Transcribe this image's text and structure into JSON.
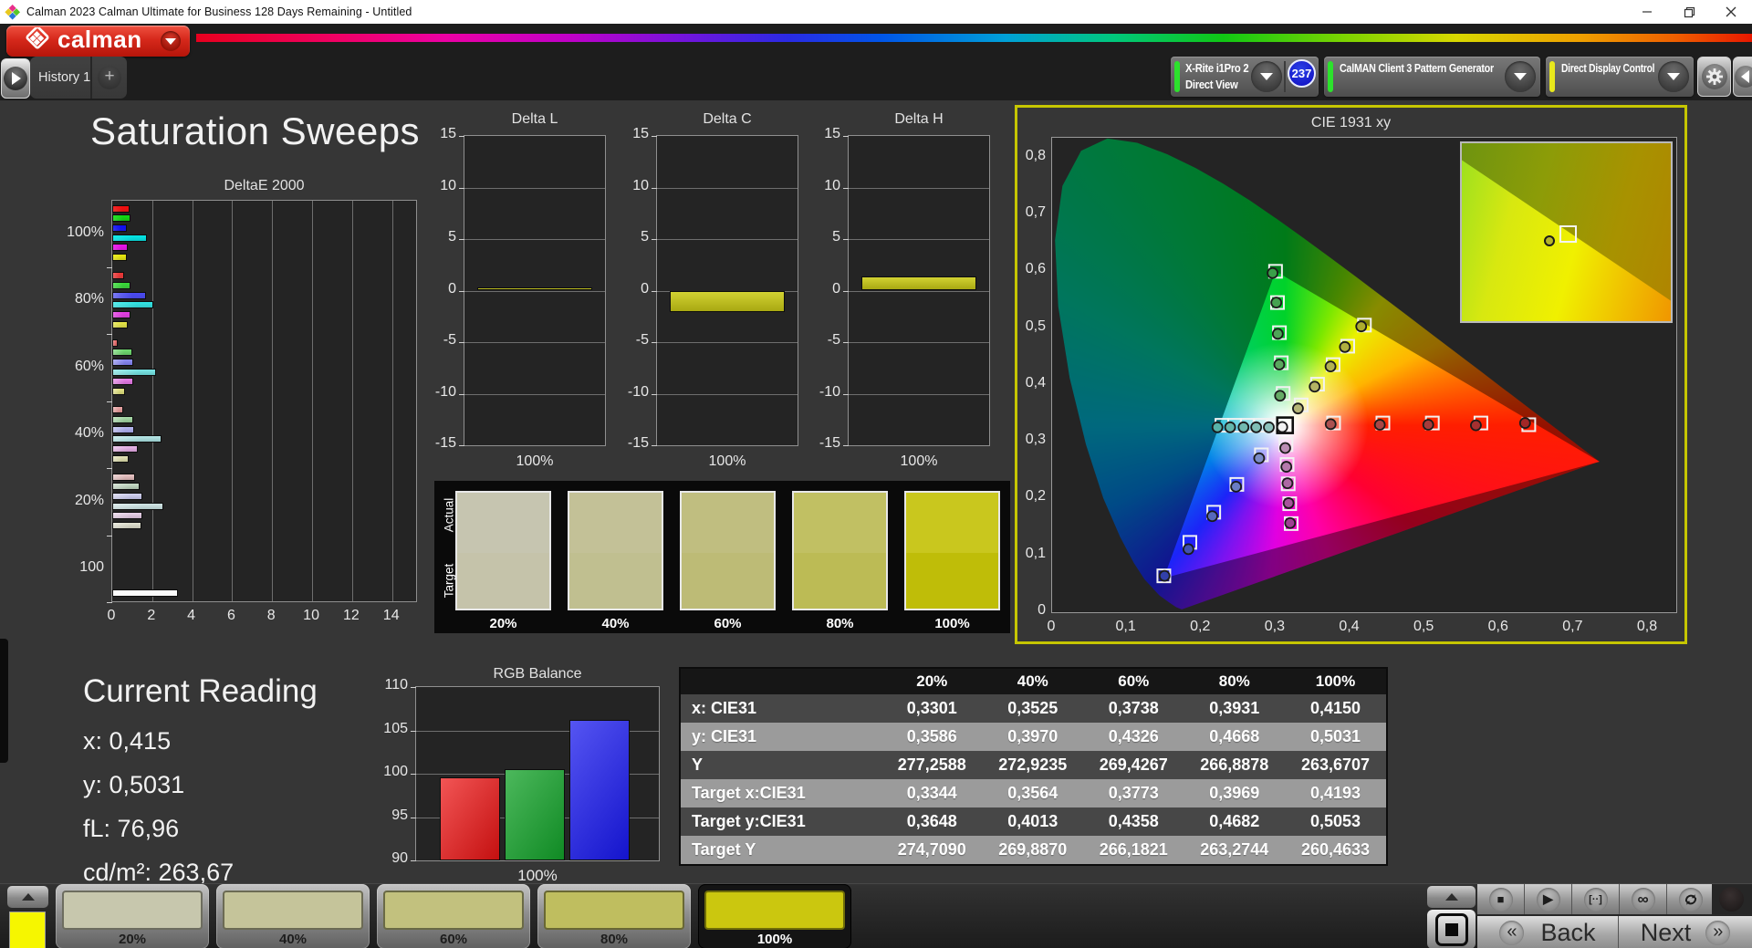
{
  "window": {
    "title": "Calman 2023 Calman Ultimate for Business 128 Days Remaining  - Untitled"
  },
  "brand": {
    "logo_text": "calman"
  },
  "tabs": {
    "items": [
      {
        "label": "History 1",
        "active": true
      }
    ],
    "add_label": "+"
  },
  "toolbar": {
    "meter": {
      "line1": "X-Rite i1Pro 2",
      "line2": "Direct View",
      "accent": "#2ce22c"
    },
    "badge": "237",
    "pattern_generator": {
      "label": "CalMAN Client 3 Pattern Generator",
      "accent": "#2ce22c"
    },
    "display_control": {
      "label": "Direct Display Control",
      "accent": "#e8e81c"
    }
  },
  "page": {
    "title": "Saturation Sweeps"
  },
  "current_reading": {
    "title": "Current Reading",
    "lines": [
      {
        "label": "x",
        "value": "0,415"
      },
      {
        "label": "y",
        "value": "0,5031"
      },
      {
        "label": "fL",
        "value": "76,96"
      },
      {
        "label": "cd/m²",
        "value": "263,67"
      }
    ]
  },
  "swatch_comparison": {
    "row_labels": [
      "Actual",
      "Target"
    ],
    "columns": [
      {
        "label": "20%",
        "actual": "#c6c5b0",
        "target": "#c5c3aa"
      },
      {
        "label": "40%",
        "actual": "#c3c197",
        "target": "#c0bf90"
      },
      {
        "label": "60%",
        "actual": "#c0be80",
        "target": "#bdbb76"
      },
      {
        "label": "80%",
        "actual": "#c1c063",
        "target": "#bcbb55"
      },
      {
        "label": "100%",
        "actual": "#c9c71e",
        "target": "#bfbd08"
      }
    ]
  },
  "table": {
    "headers": [
      "",
      "20%",
      "40%",
      "60%",
      "80%",
      "100%"
    ],
    "rows": [
      {
        "label": "x: CIE31",
        "shade": "dark",
        "values": [
          "0,3301",
          "0,3525",
          "0,3738",
          "0,3931",
          "0,4150"
        ]
      },
      {
        "label": "y: CIE31",
        "shade": "light",
        "values": [
          "0,3586",
          "0,3970",
          "0,4326",
          "0,4668",
          "0,5031"
        ]
      },
      {
        "label": "Y",
        "shade": "dark",
        "values": [
          "277,2588",
          "272,9235",
          "269,4267",
          "266,8878",
          "263,6707"
        ]
      },
      {
        "label": "Target x:CIE31",
        "shade": "light",
        "values": [
          "0,3344",
          "0,3564",
          "0,3773",
          "0,3969",
          "0,4193"
        ]
      },
      {
        "label": "Target y:CIE31",
        "shade": "dark",
        "values": [
          "0,3648",
          "0,4013",
          "0,4358",
          "0,4682",
          "0,5053"
        ]
      },
      {
        "label": "Target Y",
        "shade": "light",
        "values": [
          "274,7090",
          "269,8870",
          "266,1821",
          "263,2744",
          "260,4633"
        ]
      }
    ]
  },
  "bottom_bar": {
    "current_color": "#f6f600",
    "swatches": [
      {
        "label": "20%",
        "color": "#c7c7ad",
        "selected": false
      },
      {
        "label": "40%",
        "color": "#c5c49a",
        "selected": false
      },
      {
        "label": "60%",
        "color": "#c2c17e",
        "selected": false
      },
      {
        "label": "80%",
        "color": "#bfbe5f",
        "selected": false
      },
      {
        "label": "100%",
        "color": "#cbc70f",
        "selected": true
      }
    ],
    "transport": [
      {
        "name": "stop",
        "glyph": "■"
      },
      {
        "name": "play",
        "glyph": "▶"
      },
      {
        "name": "range",
        "glyph": "[··]"
      },
      {
        "name": "loop-infinite",
        "glyph": "∞"
      },
      {
        "name": "repeat",
        "glyph": "svg"
      }
    ],
    "back_label": "Back",
    "next_label": "Next"
  },
  "chart_data": [
    {
      "id": "deltae2000",
      "type": "bar",
      "orientation": "horizontal",
      "title": "DeltaE 2000",
      "xlim": [
        0,
        15.2
      ],
      "xticks": [
        0,
        2,
        4,
        6,
        8,
        10,
        12,
        14
      ],
      "grid": true,
      "categories": [
        "100%",
        "80%",
        "60%",
        "40%",
        "20%",
        "100"
      ],
      "groups": [
        {
          "label": "100%",
          "values": [
            0.85,
            0.92,
            0.75,
            1.75,
            0.78,
            0.75
          ],
          "colors": [
            "#d42a2a",
            "#2cb82c",
            "#2d2dd8",
            "#17c3c3",
            "#c92cc9",
            "#c6c62a"
          ]
        },
        {
          "label": "80%",
          "values": [
            0.6,
            0.92,
            1.7,
            2.05,
            0.92,
            0.78
          ],
          "colors": [
            "#cd5454",
            "#54b854",
            "#6161d4",
            "#4fc3c3",
            "#c358c3",
            "#c3c35e"
          ]
        },
        {
          "label": "60%",
          "values": [
            0.28,
            1.0,
            1.05,
            2.2,
            1.03,
            0.62
          ],
          "colors": [
            "#c97777",
            "#77b877",
            "#8585d2",
            "#7cc3c3",
            "#c47fc4",
            "#c0c081"
          ]
        },
        {
          "label": "40%",
          "values": [
            0.55,
            1.05,
            1.08,
            2.45,
            1.3,
            0.8
          ],
          "colors": [
            "#c79292",
            "#95b895",
            "#9e9ed0",
            "#9cc3c3",
            "#c59cc5",
            "#bfbf9c"
          ]
        },
        {
          "label": "20%",
          "values": [
            1.13,
            1.35,
            1.5,
            2.55,
            1.5,
            1.48
          ],
          "colors": [
            "#c4a6a6",
            "#a8b8a8",
            "#b1b1cf",
            "#b0c3c3",
            "#c4b0c4",
            "#bebeb0"
          ]
        },
        {
          "label": "100",
          "values": [
            3.3
          ],
          "colors": [
            "#f4f4f4"
          ]
        }
      ]
    },
    {
      "id": "delta_l",
      "type": "bar",
      "title": "Delta L",
      "ylim": [
        -15,
        15
      ],
      "yticks": [
        15,
        10,
        5,
        0,
        -5,
        -10,
        -15
      ],
      "categories": [
        "100%"
      ],
      "values": [
        0.35
      ],
      "bar_color": "#bcbc22",
      "xlabel": "100%"
    },
    {
      "id": "delta_c",
      "type": "bar",
      "title": "Delta C",
      "ylim": [
        -15,
        15
      ],
      "yticks": [
        15,
        10,
        5,
        0,
        -5,
        -10,
        -15
      ],
      "categories": [
        "100%"
      ],
      "values": [
        -2.1
      ],
      "bar_color": "#bcbc22",
      "xlabel": "100%"
    },
    {
      "id": "delta_h",
      "type": "bar",
      "title": "Delta H",
      "ylim": [
        -15,
        15
      ],
      "yticks": [
        15,
        10,
        5,
        0,
        -5,
        -10,
        -15
      ],
      "categories": [
        "100%"
      ],
      "values": [
        1.35
      ],
      "bar_color": "#bcbc22",
      "xlabel": "100%"
    },
    {
      "id": "rgb_balance",
      "type": "bar",
      "title": "RGB Balance",
      "ylim": [
        90,
        110
      ],
      "yticks": [
        90,
        95,
        100,
        105,
        110
      ],
      "categories": [
        "100%"
      ],
      "xlabel": "100%",
      "series": [
        {
          "name": "Red",
          "value": 99.6,
          "color_top": "#f25555",
          "color_bottom": "#c41010"
        },
        {
          "name": "Green",
          "value": 100.5,
          "color_top": "#4cb85c",
          "color_bottom": "#108a24"
        },
        {
          "name": "Blue",
          "value": 106.2,
          "color_top": "#5555f2",
          "color_bottom": "#1414cc"
        }
      ]
    },
    {
      "id": "cie1931",
      "type": "scatter",
      "title": "CIE 1931 xy",
      "xlim": [
        0,
        0.838
      ],
      "ylim": [
        0,
        0.835
      ],
      "xticks": [
        "0",
        "0,1",
        "0,2",
        "0,3",
        "0,4",
        "0,5",
        "0,6",
        "0,7",
        "0,8"
      ],
      "yticks": [
        "0",
        "0,1",
        "0,2",
        "0,3",
        "0,4",
        "0,5",
        "0,6",
        "0,7",
        "0,8"
      ],
      "white_point": {
        "target": [
          0.3127,
          0.329
        ],
        "measured": [
          0.309,
          0.326
        ]
      },
      "gamut_triangle": [
        [
          0.3,
          0.6
        ],
        [
          0.735,
          0.265
        ],
        [
          0.15,
          0.06
        ]
      ],
      "locus": [
        [
          0.1741,
          0.005
        ],
        [
          0.1666,
          0.0089
        ],
        [
          0.1566,
          0.0177
        ],
        [
          0.144,
          0.0297
        ],
        [
          0.1241,
          0.0578
        ],
        [
          0.1096,
          0.0868
        ],
        [
          0.0913,
          0.1327
        ],
        [
          0.0687,
          0.2007
        ],
        [
          0.0454,
          0.295
        ],
        [
          0.0235,
          0.4127
        ],
        [
          0.0082,
          0.5384
        ],
        [
          0.0039,
          0.6548
        ],
        [
          0.0139,
          0.7502
        ],
        [
          0.0389,
          0.812
        ],
        [
          0.0743,
          0.8338
        ],
        [
          0.1142,
          0.8262
        ],
        [
          0.1547,
          0.8059
        ],
        [
          0.1929,
          0.7816
        ],
        [
          0.2296,
          0.7543
        ],
        [
          0.2658,
          0.7243
        ],
        [
          0.3016,
          0.6923
        ],
        [
          0.3373,
          0.6589
        ],
        [
          0.3731,
          0.6245
        ],
        [
          0.4087,
          0.5896
        ],
        [
          0.4441,
          0.5547
        ],
        [
          0.4788,
          0.5202
        ],
        [
          0.5125,
          0.4866
        ],
        [
          0.5448,
          0.4544
        ],
        [
          0.5752,
          0.4242
        ],
        [
          0.6029,
          0.3965
        ],
        [
          0.627,
          0.3725
        ],
        [
          0.6482,
          0.3514
        ],
        [
          0.6658,
          0.334
        ],
        [
          0.6801,
          0.3197
        ],
        [
          0.6915,
          0.3083
        ],
        [
          0.7006,
          0.2993
        ],
        [
          0.7079,
          0.292
        ],
        [
          0.714,
          0.2859
        ],
        [
          0.719,
          0.2809
        ],
        [
          0.726,
          0.274
        ],
        [
          0.73,
          0.27
        ],
        [
          0.7347,
          0.2653
        ]
      ],
      "sweeps": [
        {
          "name": "red",
          "targets": [
            [
              0.3779,
              0.333
            ],
            [
              0.4441,
              0.333
            ],
            [
              0.5105,
              0.333
            ],
            [
              0.5757,
              0.333
            ],
            [
              0.64,
              0.33
            ]
          ],
          "measured": [
            [
              0.374,
              0.331
            ],
            [
              0.44,
              0.33
            ],
            [
              0.505,
              0.33
            ],
            [
              0.569,
              0.329
            ],
            [
              0.635,
              0.333
            ]
          ],
          "colors": [
            "#ab5151",
            "#a94646",
            "#a73a3a",
            "#a53030",
            "#a32727"
          ]
        },
        {
          "name": "green",
          "targets": [
            [
              0.3102,
              0.385
            ],
            [
              0.3077,
              0.439
            ],
            [
              0.3052,
              0.492
            ],
            [
              0.3026,
              0.545
            ],
            [
              0.3,
              0.6
            ]
          ],
          "measured": [
            [
              0.306,
              0.381
            ],
            [
              0.305,
              0.436
            ],
            [
              0.303,
              0.49
            ],
            [
              0.301,
              0.545
            ],
            [
              0.296,
              0.597
            ]
          ],
          "colors": [
            "#66aa66",
            "#5aa75e",
            "#4fa557",
            "#45a250",
            "#3a9f48"
          ]
        },
        {
          "name": "blue",
          "targets": [
            [
              0.281,
              0.277
            ],
            [
              0.248,
              0.225
            ],
            [
              0.217,
              0.176
            ],
            [
              0.185,
              0.123
            ],
            [
              0.15,
              0.064
            ]
          ],
          "measured": [
            [
              0.278,
              0.271
            ],
            [
              0.247,
              0.221
            ],
            [
              0.215,
              0.169
            ],
            [
              0.183,
              0.111
            ],
            [
              0.151,
              0.064
            ]
          ],
          "colors": [
            "#7c8cc8",
            "#6a7cc4",
            "#5668bc",
            "#4252b4",
            "#3240aa"
          ]
        },
        {
          "name": "cyan",
          "targets": [
            [
              0.297,
              0.329
            ],
            [
              0.28,
              0.329
            ],
            [
              0.262,
              0.329
            ],
            [
              0.245,
              0.329
            ],
            [
              0.228,
              0.329
            ]
          ],
          "measured": [
            [
              0.291,
              0.3255
            ],
            [
              0.274,
              0.3255
            ],
            [
              0.257,
              0.3255
            ],
            [
              0.239,
              0.3255
            ],
            [
              0.222,
              0.3255
            ]
          ],
          "colors": [
            "#8cc2bc",
            "#7fbeb6",
            "#72bab0",
            "#64b6ac",
            "#57b3a8"
          ]
        },
        {
          "name": "magenta",
          "targets": [
            [
              0.314,
              0.295
            ],
            [
              0.3155,
              0.26
            ],
            [
              0.317,
              0.226
            ],
            [
              0.319,
              0.191
            ],
            [
              0.321,
              0.156
            ]
          ],
          "measured": [
            [
              0.313,
              0.289
            ],
            [
              0.3145,
              0.256
            ],
            [
              0.316,
              0.227
            ],
            [
              0.3175,
              0.192
            ],
            [
              0.3195,
              0.157
            ]
          ],
          "colors": [
            "#bb8cb4",
            "#b57aac",
            "#ad68a4",
            "#a6549c",
            "#9e4093"
          ]
        },
        {
          "name": "yellow",
          "targets": [
            [
              0.3344,
              0.3648
            ],
            [
              0.3564,
              0.4013
            ],
            [
              0.3773,
              0.4358
            ],
            [
              0.3969,
              0.4682
            ],
            [
              0.4193,
              0.5053
            ]
          ],
          "measured": [
            [
              0.3301,
              0.3586
            ],
            [
              0.3525,
              0.397
            ],
            [
              0.3738,
              0.4326
            ],
            [
              0.3931,
              0.4668
            ],
            [
              0.415,
              0.5031
            ]
          ],
          "colors": [
            "#b5b576",
            "#b3b364",
            "#b1b152",
            "#afaf40",
            "#adad2e"
          ]
        }
      ],
      "inset": {
        "square": [
          0.494,
          0.492
        ],
        "circle": [
          0.412,
          0.54
        ],
        "circle_color": "#b5b52a",
        "boundary": [
          [
            0,
            0.095
          ],
          [
            1,
            0.885
          ]
        ]
      }
    }
  ]
}
